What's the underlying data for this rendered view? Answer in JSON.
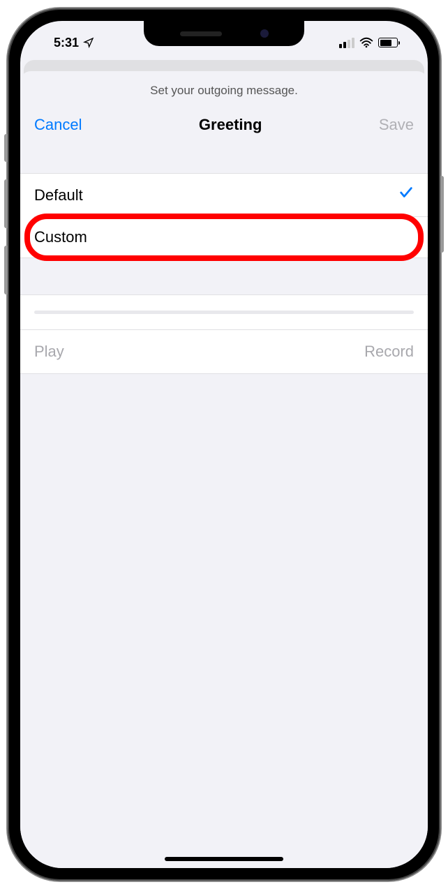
{
  "status_bar": {
    "time": "5:31",
    "location_services": true,
    "signal_strength": 2,
    "wifi": true,
    "battery_percent": 70
  },
  "sheet": {
    "subtitle": "Set your outgoing message.",
    "cancel_label": "Cancel",
    "title": "Greeting",
    "save_label": "Save",
    "save_enabled": false
  },
  "options": [
    {
      "label": "Default",
      "selected": true,
      "highlighted": false
    },
    {
      "label": "Custom",
      "selected": false,
      "highlighted": true
    }
  ],
  "playback": {
    "play_label": "Play",
    "record_label": "Record",
    "play_enabled": false,
    "record_enabled": false,
    "progress": 0
  }
}
